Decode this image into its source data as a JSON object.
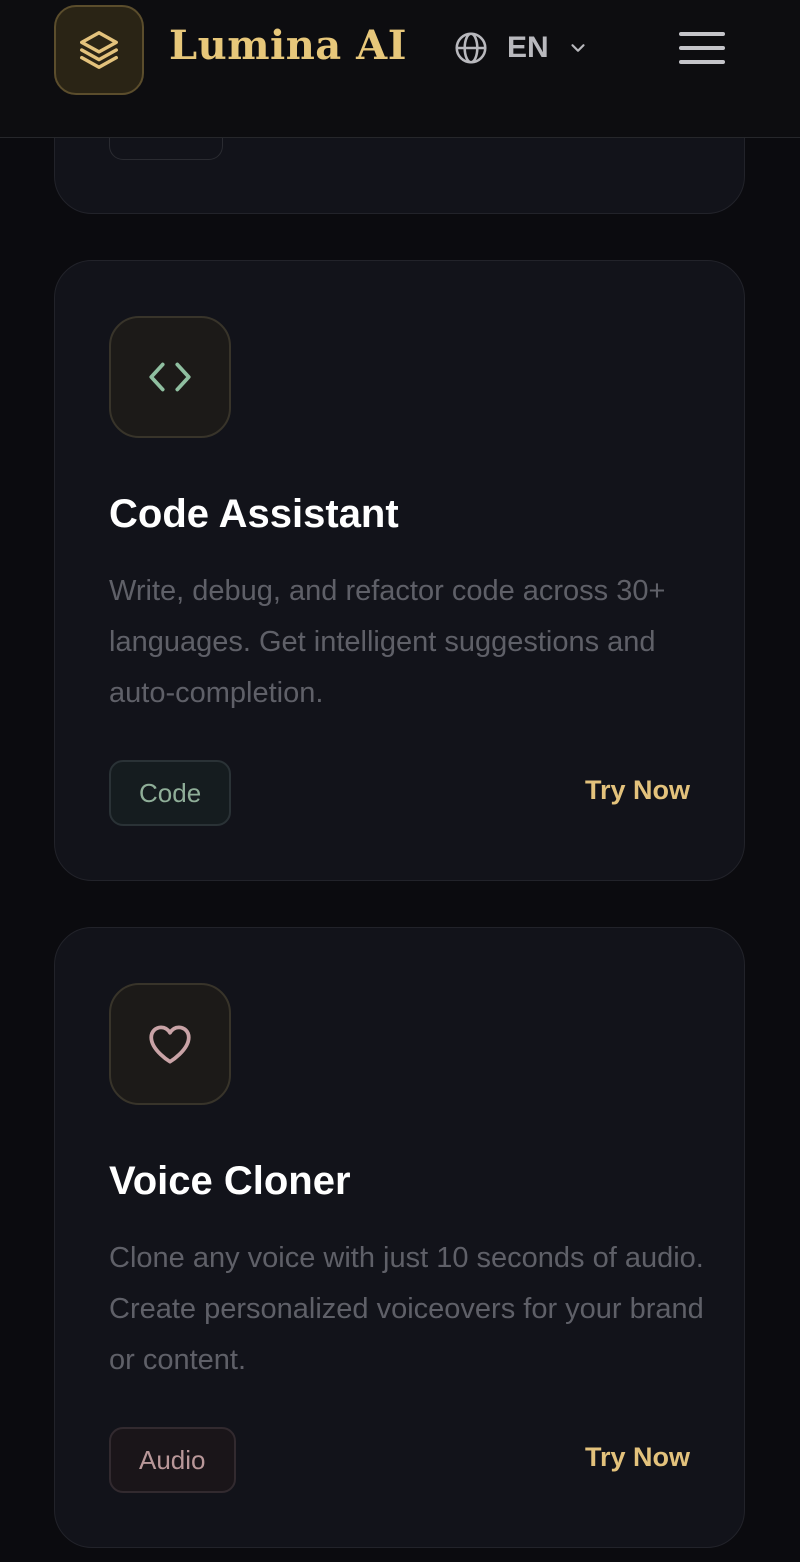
{
  "header": {
    "brand": "Lumina AI",
    "language": "EN",
    "logo_icon": "layers-icon",
    "globe_icon": "globe-icon",
    "menu_icon": "hamburger-menu-icon"
  },
  "cards": [
    {
      "title": "Code Assistant",
      "description": "Write, debug, and refactor code across 30+ languages. Get intelligent suggestions and auto-completion.",
      "tag": "Code",
      "action": "Try Now",
      "icon": "code-icon"
    },
    {
      "title": "Voice Cloner",
      "description": "Clone any voice with just 10 seconds of audio. Create personalized voiceovers for your brand or content.",
      "tag": "Audio",
      "action": "Try Now",
      "icon": "heart-icon"
    }
  ],
  "colors": {
    "accent": "#e3c27c",
    "background": "#0b0b0f",
    "card": "#12131a",
    "code_icon": "#8fbfa0",
    "heart_icon": "#c9a3a6"
  }
}
